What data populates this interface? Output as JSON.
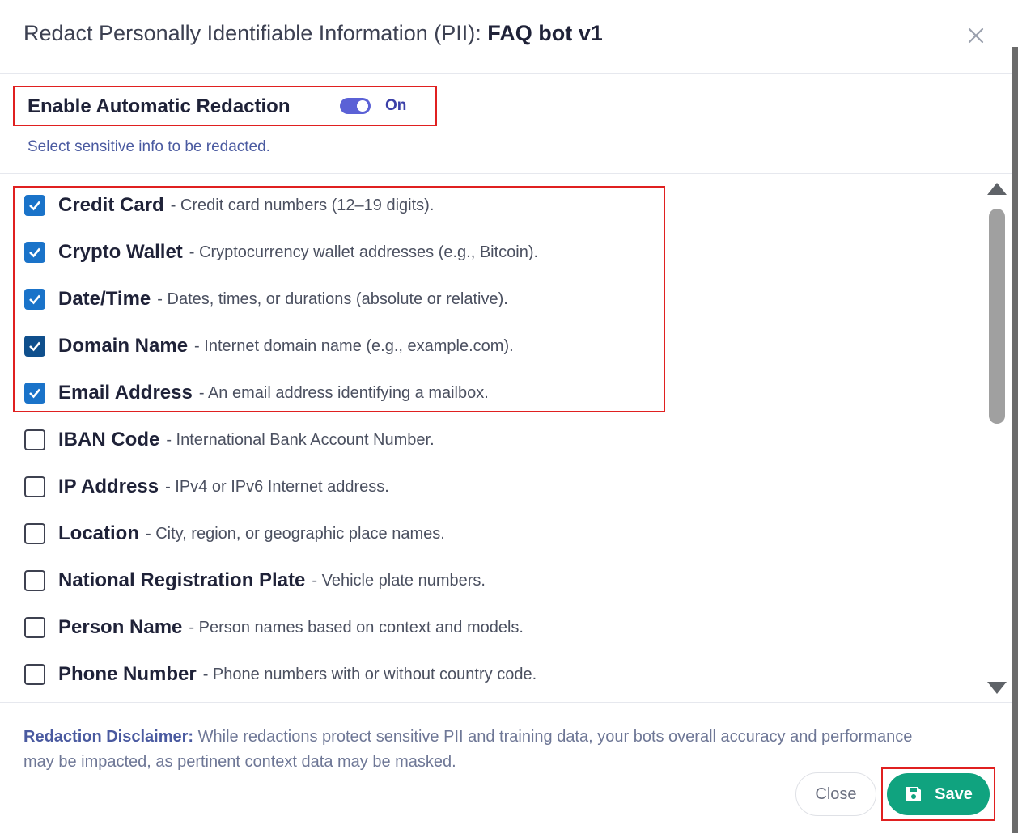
{
  "header": {
    "title_prefix": "Redact Personally Identifiable Information (PII): ",
    "bot_name": "FAQ bot v1",
    "close_icon": "close-icon"
  },
  "redaction": {
    "toggle_label": "Enable Automatic Redaction",
    "toggle_state": "On",
    "toggle_on": true,
    "subtitle": "Select sensitive info to be redacted."
  },
  "items": [
    {
      "name": "Credit Card",
      "desc": "- Credit card numbers (12–19 digits).",
      "checked": true
    },
    {
      "name": "Crypto Wallet",
      "desc": "- Cryptocurrency wallet addresses (e.g., Bitcoin).",
      "checked": true
    },
    {
      "name": "Date/Time",
      "desc": "- Dates, times, or durations (absolute or relative).",
      "checked": true
    },
    {
      "name": "Domain Name",
      "desc": "- Internet domain name (e.g., example.com).",
      "checked": true
    },
    {
      "name": "Email Address",
      "desc": "- An email address identifying a mailbox.",
      "checked": true
    },
    {
      "name": "IBAN Code",
      "desc": "- International Bank Account Number.",
      "checked": false
    },
    {
      "name": "IP Address",
      "desc": "- IPv4 or IPv6 Internet address.",
      "checked": false
    },
    {
      "name": "Location",
      "desc": "- City, region, or geographic place names.",
      "checked": false
    },
    {
      "name": "National Registration Plate",
      "desc": "- Vehicle plate numbers.",
      "checked": false
    },
    {
      "name": "Person Name",
      "desc": "- Person names based on context and models.",
      "checked": false
    },
    {
      "name": "Phone Number",
      "desc": "- Phone numbers with or without country code.",
      "checked": false
    }
  ],
  "footer": {
    "disclaimer_label": "Redaction Disclaimer:",
    "disclaimer_text": " While redactions protect sensitive PII and training data, your bots overall accuracy and performance may be impacted, as pertinent context data may be masked.",
    "close_label": "Close",
    "save_label": "Save",
    "save_icon": "floppy-disk-icon"
  },
  "colors": {
    "accent": "#5b61d6",
    "save": "#10a37f",
    "checkbox": "#1a73c9",
    "highlight": "#e02020"
  }
}
